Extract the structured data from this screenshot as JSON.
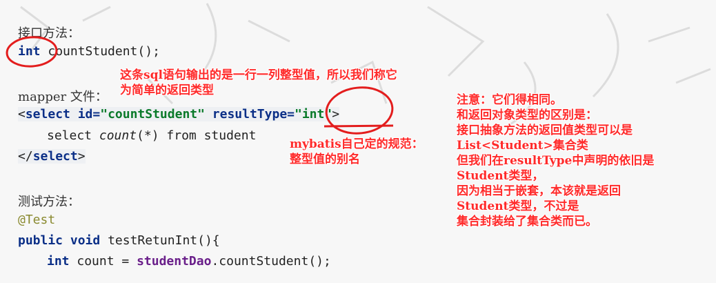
{
  "doc": {
    "interface_label": "接口方法：",
    "interface_sig": {
      "kw": "int",
      "rest": " countStudent();"
    },
    "mapper_label": "mapper 文件：",
    "select_open": {
      "open": "<",
      "tag": "select",
      "attr1": " id=",
      "val1": "\"countStudent\"",
      "attr2": " resultType=",
      "val2": "\"int\"",
      "close": ">"
    },
    "select_body": {
      "pre": "select ",
      "fn": "count",
      "post": "(*) from student"
    },
    "select_close": {
      "open": "</",
      "tag": "select",
      "close": ">"
    },
    "test_label": "测试方法：",
    "annotation": "@Test",
    "test_sig": {
      "kw1": "public",
      "kw2": "void",
      "rest": " testRetunInt(){"
    },
    "test_body": {
      "kw": "int",
      "mid": " count = ",
      "field": "studentDao",
      "rest": ".countStudent();"
    }
  },
  "annotations": {
    "note1": "这条sql语句输出的是一行一列整型值，所以我们称它\n为简单的返回类型",
    "note2": "mybatis自己定的规范：\n整型值的别名",
    "note3": "注意：它们得相同。\n和返回对象类型的区别是：\n接口抽象方法的返回值类型可以是\nList<Student>集合类\n但我们在resultType中声明的依旧是\nStudent类型，\n因为相当于嵌套，本该就是返回\nStudent类型，不过是\n集合封装给了集合类而已。"
  },
  "colors": {
    "annotation_red": "#ff2a2a",
    "keyword": "#0b2f87",
    "string": "#0a7a2a",
    "field": "#6a1f8a"
  }
}
